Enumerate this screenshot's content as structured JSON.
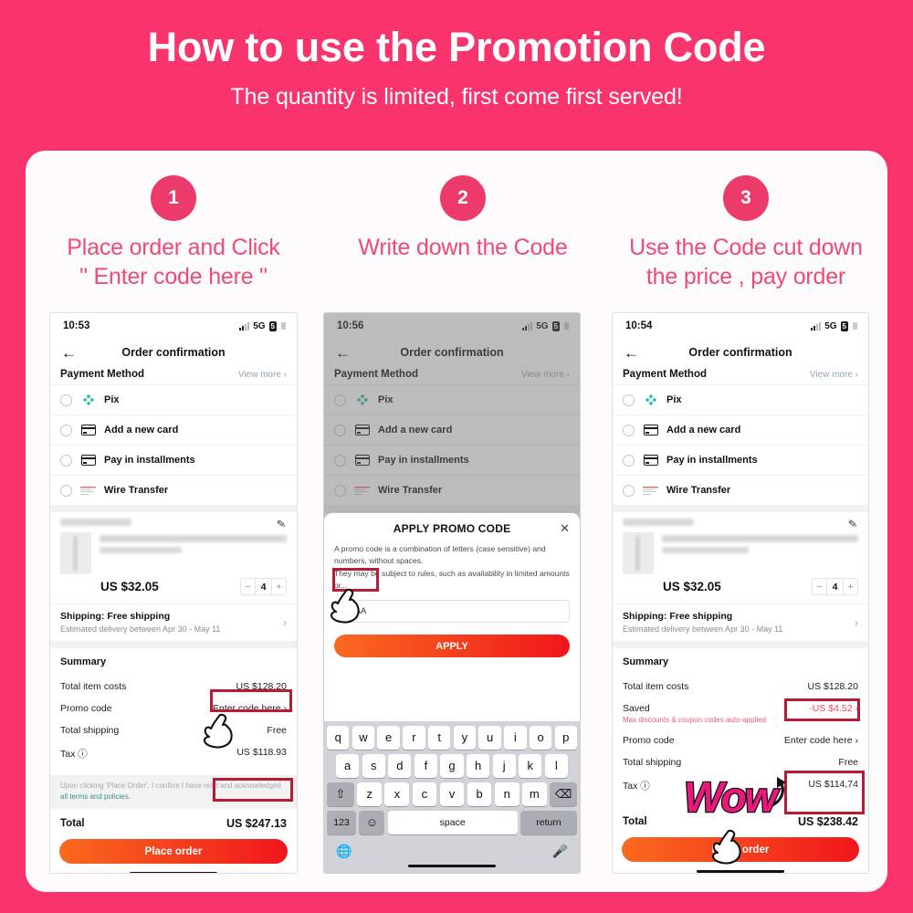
{
  "header": {
    "title": "How to use the Promotion Code",
    "subtitle": "The quantity is limited, first come first served!"
  },
  "colors": {
    "brand_pink": "#f9336b",
    "step_title": "#ef4a78",
    "highlight_red": "#b81b36",
    "cta_orange": "#fa6a1e",
    "cta_red": "#f0161c",
    "link_teal": "#3a8f94",
    "pix_green": "#32bcad"
  },
  "steps": [
    {
      "number": "1",
      "title": "Place order and Click\n\" Enter code here \""
    },
    {
      "number": "2",
      "title": "Write down the Code"
    },
    {
      "number": "3",
      "title": "Use the Code cut down\nthe price , pay order"
    }
  ],
  "common": {
    "nav_title": "Order confirmation",
    "back_icon": "back-arrow-icon",
    "network": "5G",
    "battery": "5",
    "payment_method_label": "Payment Method",
    "view_more": "View more",
    "payment_options": [
      {
        "label": "Pix",
        "icon": "pix-icon"
      },
      {
        "label": "Add a new card",
        "icon": "credit-card-icon"
      },
      {
        "label": "Pay in installments",
        "icon": "credit-card-icon"
      },
      {
        "label": "Wire Transfer",
        "icon": "wire-transfer-icon"
      }
    ],
    "product_price": "US $32.05",
    "quantity": "4",
    "shipping_title": "Shipping: Free shipping",
    "shipping_sub": "Estimated delivery between Apr 30 - May 11",
    "summary_label": "Summary",
    "terms_text": "Upon clicking 'Place Order', I confirm I have read and acknowledged",
    "terms_link": "all terms and policies.",
    "place_order": "Place order",
    "total_label": "Total",
    "total_item_costs_label": "Total item costs",
    "total_item_costs_value": "US $128.20",
    "promo_code_label": "Promo code",
    "promo_code_value": "Enter code here",
    "total_shipping_label": "Total shipping",
    "total_shipping_value": "Free",
    "tax_label": "Tax"
  },
  "phone1": {
    "time": "10:53",
    "tax_value": "US $118.93",
    "total_value": "US $247.13"
  },
  "phone2": {
    "time": "10:56",
    "modal_title": "APPLY PROMO CODE",
    "modal_close": "close-icon",
    "modal_body": "A promo code is a combination of letters (case sensitive) and numbers, without spaces.\nThey may be subject to rules, such as availability in limited amounts or...",
    "code_value": "AAAA",
    "apply_label": "APPLY",
    "keyboard": {
      "row1": [
        "q",
        "w",
        "e",
        "r",
        "t",
        "y",
        "u",
        "i",
        "o",
        "p"
      ],
      "row2": [
        "a",
        "s",
        "d",
        "f",
        "g",
        "h",
        "j",
        "k",
        "l"
      ],
      "row3": [
        "z",
        "x",
        "c",
        "v",
        "b",
        "n",
        "m"
      ],
      "shift": "shift-icon",
      "backspace": "backspace-icon",
      "numbers": "123",
      "emoji": "emoji-icon",
      "space": "space",
      "return": "return",
      "globe": "globe-icon",
      "mic": "microphone-icon"
    }
  },
  "phone3": {
    "time": "10:54",
    "saved_label": "Saved",
    "saved_sub": "Max discounts & coupon codes auto-applied",
    "saved_value": "-US $4.52",
    "tax_value": "US $114,74",
    "total_value": "US $238.42",
    "wow_text": "Wow"
  }
}
